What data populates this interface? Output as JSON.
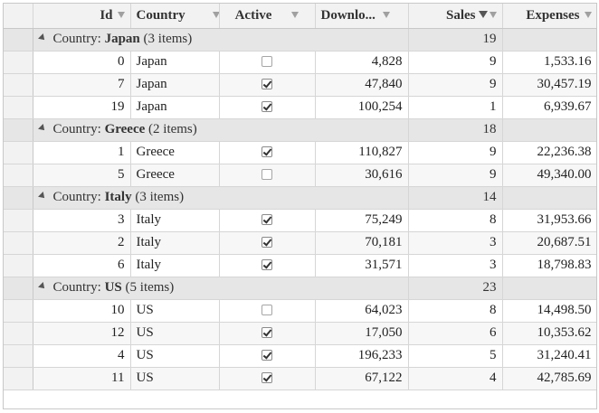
{
  "headers": [
    {
      "key": "id",
      "label": "Id"
    },
    {
      "key": "country",
      "label": "Country"
    },
    {
      "key": "active",
      "label": "Active"
    },
    {
      "key": "downloads",
      "label": "Downlo..."
    },
    {
      "key": "sales",
      "label": "Sales"
    },
    {
      "key": "expenses",
      "label": "Expenses"
    }
  ],
  "groups": [
    {
      "prefix": "Country: ",
      "name": "Japan",
      "count": "(3 items)",
      "sales_total": "19",
      "rows": [
        {
          "id": "0",
          "country": "Japan",
          "active": false,
          "downloads": "4,828",
          "sales": "9",
          "expenses": "1,533.16"
        },
        {
          "id": "7",
          "country": "Japan",
          "active": true,
          "downloads": "47,840",
          "sales": "9",
          "expenses": "30,457.19"
        },
        {
          "id": "19",
          "country": "Japan",
          "active": true,
          "downloads": "100,254",
          "sales": "1",
          "expenses": "6,939.67"
        }
      ]
    },
    {
      "prefix": "Country: ",
      "name": "Greece",
      "count": "(2 items)",
      "sales_total": "18",
      "rows": [
        {
          "id": "1",
          "country": "Greece",
          "active": true,
          "downloads": "110,827",
          "sales": "9",
          "expenses": "22,236.38"
        },
        {
          "id": "5",
          "country": "Greece",
          "active": false,
          "downloads": "30,616",
          "sales": "9",
          "expenses": "49,340.00"
        }
      ]
    },
    {
      "prefix": "Country: ",
      "name": "Italy",
      "count": "(3 items)",
      "sales_total": "14",
      "rows": [
        {
          "id": "3",
          "country": "Italy",
          "active": true,
          "downloads": "75,249",
          "sales": "8",
          "expenses": "31,953.66"
        },
        {
          "id": "2",
          "country": "Italy",
          "active": true,
          "downloads": "70,181",
          "sales": "3",
          "expenses": "20,687.51"
        },
        {
          "id": "6",
          "country": "Italy",
          "active": true,
          "downloads": "31,571",
          "sales": "3",
          "expenses": "18,798.83"
        }
      ]
    },
    {
      "prefix": "Country: ",
      "name": "US",
      "count": "(5 items)",
      "sales_total": "23",
      "rows": [
        {
          "id": "10",
          "country": "US",
          "active": false,
          "downloads": "64,023",
          "sales": "8",
          "expenses": "14,498.50"
        },
        {
          "id": "12",
          "country": "US",
          "active": true,
          "downloads": "17,050",
          "sales": "6",
          "expenses": "10,353.62"
        },
        {
          "id": "4",
          "country": "US",
          "active": true,
          "downloads": "196,233",
          "sales": "5",
          "expenses": "31,240.41"
        },
        {
          "id": "11",
          "country": "US",
          "active": true,
          "downloads": "67,122",
          "sales": "4",
          "expenses": "42,785.69"
        }
      ]
    }
  ],
  "icons": {
    "filter": "filter-icon",
    "sort": "sort-descending-icon",
    "collapse": "collapse-group-icon",
    "checkbox": "checkbox-icon"
  }
}
